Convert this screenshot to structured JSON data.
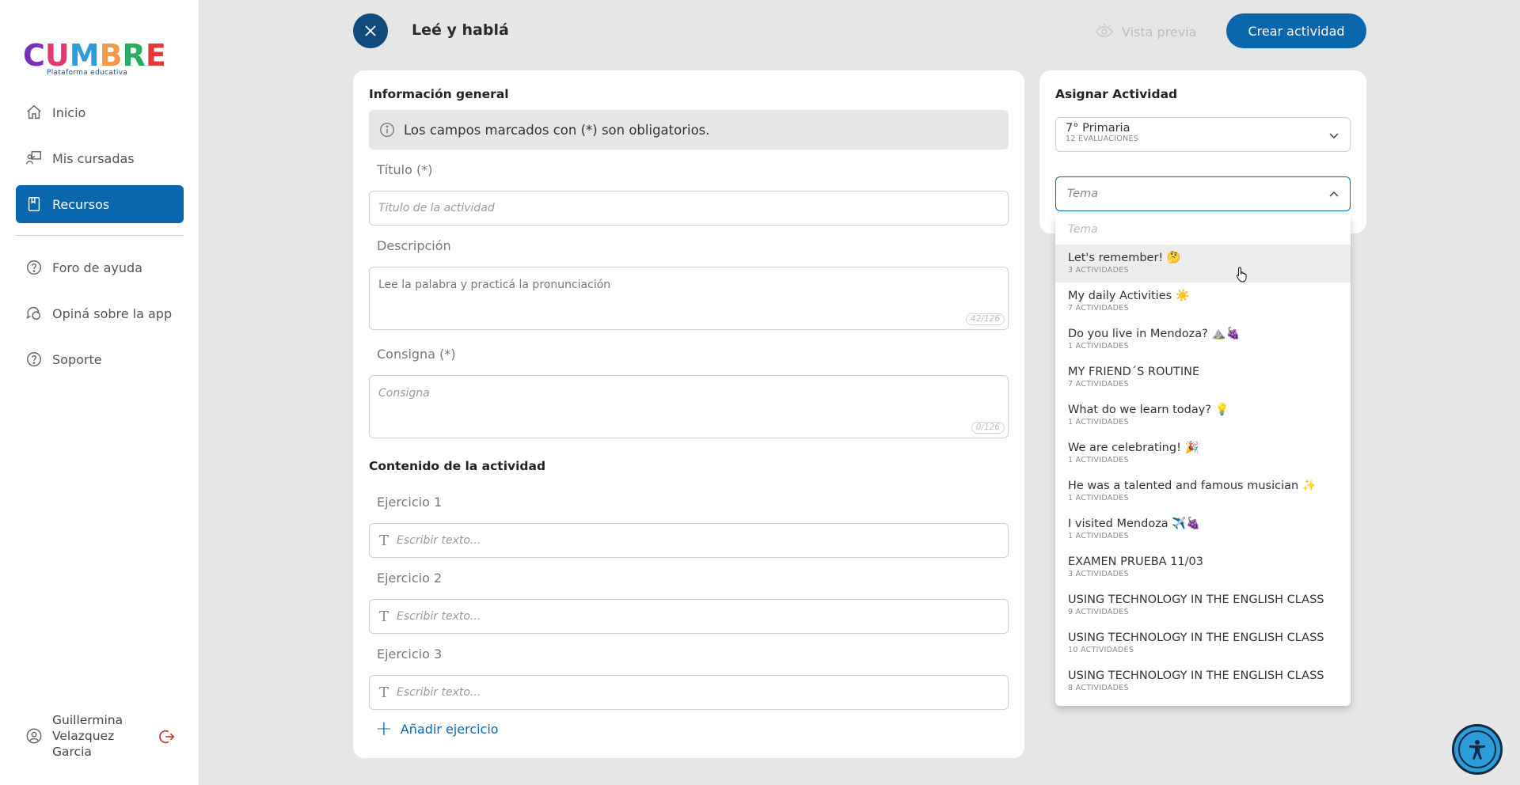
{
  "app": {
    "logo_text": "CUMBRE",
    "logo_subtitle": "Plataforma educativa",
    "brand_colors": [
      "#7b2fbe",
      "#e5386d",
      "#2d9cdb",
      "#f2994a",
      "#27ae60",
      "#e53935"
    ]
  },
  "sidebar": {
    "items": [
      {
        "label": "Inicio",
        "icon": "home-icon"
      },
      {
        "label": "Mis cursadas",
        "icon": "teacher-board-icon"
      },
      {
        "label": "Recursos",
        "icon": "book-icon",
        "active": true
      },
      {
        "label": "Foro de ayuda",
        "icon": "help-circle-icon"
      },
      {
        "label": "Opiná sobre la app",
        "icon": "chat-bubbles-icon"
      },
      {
        "label": "Soporte",
        "icon": "help-circle-icon"
      }
    ],
    "user_name": "Guillermina Velazquez Garcia"
  },
  "header": {
    "title": "Leé y hablá",
    "preview_label": "Vista previa",
    "create_label": "Crear actividad",
    "accent": "#0a66ad"
  },
  "form": {
    "general_title": "Información general",
    "info_note": "Los campos marcados con (*) son obligatorios.",
    "title_label": "Título (*)",
    "title_placeholder": "Titulo de la actividad",
    "description_label": "Descripción",
    "description_value": "Lee la palabra y practicá la pronunciación",
    "description_counter": "42/126",
    "instruction_label": "Consigna (*)",
    "instruction_placeholder": "Consigna",
    "instruction_counter": "0/126",
    "content_title": "Contenido de la actividad",
    "exercises": [
      {
        "label": "Ejercicio 1",
        "placeholder": "Escribir texto..."
      },
      {
        "label": "Ejercicio 2",
        "placeholder": "Escribir texto..."
      },
      {
        "label": "Ejercicio 3",
        "placeholder": "Escribir texto..."
      }
    ],
    "add_exercise": "Añadir ejercicio"
  },
  "assign": {
    "title": "Asignar Actividad",
    "course": "7° Primaria",
    "course_sub": "12 EVALUACIONES",
    "topic_placeholder": "Tema",
    "dropdown_placeholder": "Tema",
    "options": [
      {
        "name": "Let's remember! 🤔",
        "count": "3 ACTIVIDADES"
      },
      {
        "name": "My daily Activities ☀️",
        "count": "7 ACTIVIDADES"
      },
      {
        "name": "Do you live in Mendoza? ⛰️🍇",
        "count": "1 ACTIVIDADES"
      },
      {
        "name": "MY FRIEND´S ROUTINE",
        "count": "7 ACTIVIDADES"
      },
      {
        "name": "What do we learn today? 💡",
        "count": "1 ACTIVIDADES"
      },
      {
        "name": "We are celebrating! 🎉",
        "count": "1 ACTIVIDADES"
      },
      {
        "name": "He was a talented and famous musician ✨",
        "count": "1 ACTIVIDADES"
      },
      {
        "name": "I visited Mendoza ✈️🍇",
        "count": "1 ACTIVIDADES"
      },
      {
        "name": "EXAMEN PRUEBA 11/03",
        "count": "3 ACTIVIDADES"
      },
      {
        "name": "USING TECHNOLOGY IN THE ENGLISH CLASS",
        "count": "9 ACTIVIDADES"
      },
      {
        "name": "USING TECHNOLOGY IN THE ENGLISH CLASS",
        "count": "10 ACTIVIDADES"
      },
      {
        "name": "USING TECHNOLOGY IN THE ENGLISH CLASS",
        "count": "8 ACTIVIDADES"
      }
    ]
  }
}
